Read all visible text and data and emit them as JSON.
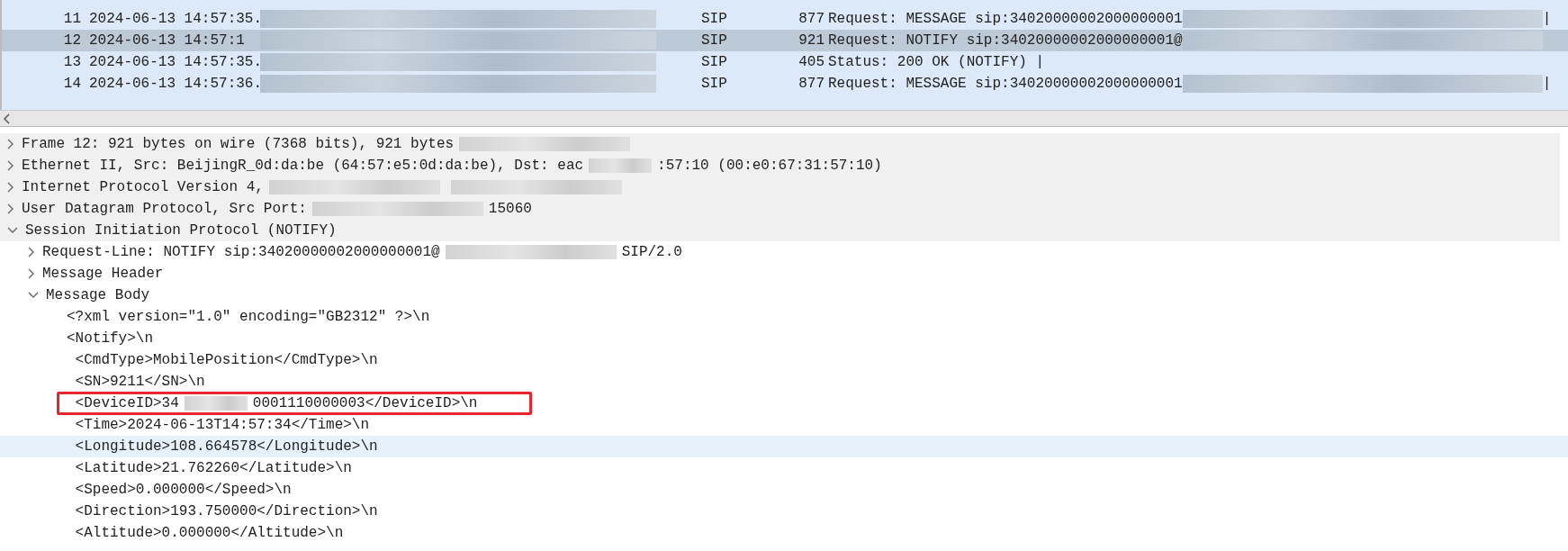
{
  "packets": [
    {
      "no": "11",
      "time": "2024-06-13 14:57:35.",
      "protocol": "SIP",
      "length": "877",
      "info": [
        {
          "kind": "text",
          "text": "Request: MESSAGE sip:34020000002000000001"
        },
        {
          "kind": "redacted"
        },
        {
          "kind": "text",
          "text": "|"
        }
      ],
      "selected": false
    },
    {
      "no": "12",
      "time": "2024-06-13 14:57:1",
      "protocol": "SIP",
      "length": "921",
      "info": [
        {
          "kind": "text",
          "text": "Request: NOTIFY sip:34020000002000000001@"
        },
        {
          "kind": "redacted"
        }
      ],
      "selected": true
    },
    {
      "no": "13",
      "time": "2024-06-13 14:57:35.",
      "protocol": "SIP",
      "length": "405",
      "info": [
        {
          "kind": "text",
          "text": "Status: 200 OK (NOTIFY) |"
        }
      ],
      "selected": false
    },
    {
      "no": "14",
      "time": "2024-06-13 14:57:36.",
      "protocol": "SIP",
      "length": "877",
      "info": [
        {
          "kind": "text",
          "text": "Request: MESSAGE sip:34020000002000000001"
        },
        {
          "kind": "redacted"
        },
        {
          "kind": "text",
          "text": "|"
        }
      ],
      "selected": false
    }
  ],
  "details": [
    {
      "expanded": false,
      "segments": [
        {
          "kind": "text",
          "text": "Frame 12: 921 bytes on wire (7368 bits), 921 bytes"
        },
        {
          "kind": "redacted"
        }
      ]
    },
    {
      "expanded": false,
      "segments": [
        {
          "kind": "text",
          "text": "Ethernet II, Src: BeijingR_0d:da:be (64:57:e5:0d:da:be), Dst: eac"
        },
        {
          "kind": "redacted-short"
        },
        {
          "kind": "text",
          "text": ":57:10 (00:e0:67:31:57:10)"
        }
      ]
    },
    {
      "expanded": false,
      "segments": [
        {
          "kind": "text",
          "text": "Internet Protocol Version 4,"
        },
        {
          "kind": "redacted"
        },
        {
          "kind": "redacted"
        }
      ]
    },
    {
      "expanded": false,
      "segments": [
        {
          "kind": "text",
          "text": "User Datagram Protocol, Src Port:"
        },
        {
          "kind": "redacted"
        },
        {
          "kind": "text",
          "text": "15060"
        }
      ]
    },
    {
      "expanded": true,
      "segments": [
        {
          "kind": "text",
          "text": "Session Initiation Protocol (NOTIFY)"
        }
      ],
      "children": [
        {
          "expanded": false,
          "segments": [
            {
              "kind": "text",
              "text": "Request-Line: NOTIFY sip:34020000002000000001@"
            },
            {
              "kind": "redacted"
            },
            {
              "kind": "text",
              "text": "SIP/2.0"
            }
          ]
        },
        {
          "expanded": false,
          "segments": [
            {
              "kind": "text",
              "text": "Message Header"
            }
          ]
        },
        {
          "expanded": true,
          "segments": [
            {
              "kind": "text",
              "text": "Message Body"
            }
          ],
          "children": [
            {
              "segments": [
                {
                  "kind": "text",
                  "text": "<?xml version=\"1.0\" encoding=\"GB2312\" ?>\\n"
                }
              ]
            },
            {
              "segments": [
                {
                  "kind": "text",
                  "text": "<Notify>\\n"
                }
              ]
            },
            {
              "segments": [
                {
                  "kind": "text",
                  "text": " <CmdType>MobilePosition</CmdType>\\n"
                }
              ]
            },
            {
              "segments": [
                {
                  "kind": "text",
                  "text": " <SN>9211</SN>\\n"
                }
              ]
            },
            {
              "boxed": true,
              "segments": [
                {
                  "kind": "text",
                  "text": " <DeviceID>34"
                },
                {
                  "kind": "redacted-short"
                },
                {
                  "kind": "text",
                  "text": "0001110000003</DeviceID>\\n"
                }
              ]
            },
            {
              "segments": [
                {
                  "kind": "text",
                  "text": " <Time>2024-06-13T14:57:34</Time>\\n"
                }
              ]
            },
            {
              "highlighted": true,
              "segments": [
                {
                  "kind": "text",
                  "text": " <Longitude>108.664578</Longitude>\\n"
                }
              ]
            },
            {
              "segments": [
                {
                  "kind": "text",
                  "text": " <Latitude>21.762260</Latitude>\\n"
                }
              ]
            },
            {
              "segments": [
                {
                  "kind": "text",
                  "text": " <Speed>0.000000</Speed>\\n"
                }
              ]
            },
            {
              "segments": [
                {
                  "kind": "text",
                  "text": " <Direction>193.750000</Direction>\\n"
                }
              ]
            },
            {
              "segments": [
                {
                  "kind": "text",
                  "text": " <Altitude>0.000000</Altitude>\\n"
                }
              ]
            }
          ]
        }
      ]
    }
  ]
}
